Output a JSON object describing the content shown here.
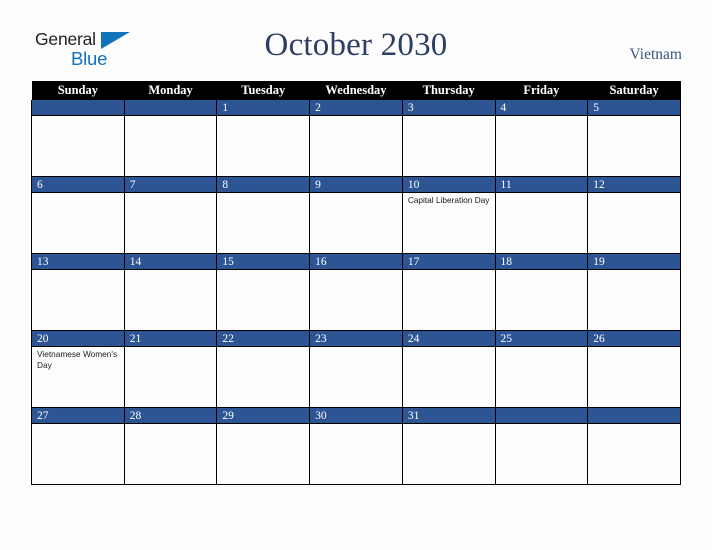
{
  "brand": {
    "word1": "General",
    "word2": "Blue",
    "triangle_icon": "blue-triangle-icon",
    "word1_color": "#231f20",
    "word2_color": "#1273bd"
  },
  "header": {
    "title": "October 2030",
    "country": "Vietnam",
    "title_color": "#2b3e63",
    "country_color": "#3c5580"
  },
  "calendar": {
    "header_bg": "#000000",
    "daynum_bg": "#2e5593",
    "cell_bg": "#fdfdfd",
    "weekday_headers": [
      "Sunday",
      "Monday",
      "Tuesday",
      "Wednesday",
      "Thursday",
      "Friday",
      "Saturday"
    ],
    "weeks": [
      [
        {
          "day": "",
          "events": []
        },
        {
          "day": "",
          "events": []
        },
        {
          "day": "1",
          "events": []
        },
        {
          "day": "2",
          "events": []
        },
        {
          "day": "3",
          "events": []
        },
        {
          "day": "4",
          "events": []
        },
        {
          "day": "5",
          "events": []
        }
      ],
      [
        {
          "day": "6",
          "events": []
        },
        {
          "day": "7",
          "events": []
        },
        {
          "day": "8",
          "events": []
        },
        {
          "day": "9",
          "events": []
        },
        {
          "day": "10",
          "events": [
            "Capital Liberation Day"
          ]
        },
        {
          "day": "11",
          "events": []
        },
        {
          "day": "12",
          "events": []
        }
      ],
      [
        {
          "day": "13",
          "events": []
        },
        {
          "day": "14",
          "events": []
        },
        {
          "day": "15",
          "events": []
        },
        {
          "day": "16",
          "events": []
        },
        {
          "day": "17",
          "events": []
        },
        {
          "day": "18",
          "events": []
        },
        {
          "day": "19",
          "events": []
        }
      ],
      [
        {
          "day": "20",
          "events": [
            "Vietnamese Women's Day"
          ]
        },
        {
          "day": "21",
          "events": []
        },
        {
          "day": "22",
          "events": []
        },
        {
          "day": "23",
          "events": []
        },
        {
          "day": "24",
          "events": []
        },
        {
          "day": "25",
          "events": []
        },
        {
          "day": "26",
          "events": []
        }
      ],
      [
        {
          "day": "27",
          "events": []
        },
        {
          "day": "28",
          "events": []
        },
        {
          "day": "29",
          "events": []
        },
        {
          "day": "30",
          "events": []
        },
        {
          "day": "31",
          "events": []
        },
        {
          "day": "",
          "events": []
        },
        {
          "day": "",
          "events": []
        }
      ]
    ]
  }
}
